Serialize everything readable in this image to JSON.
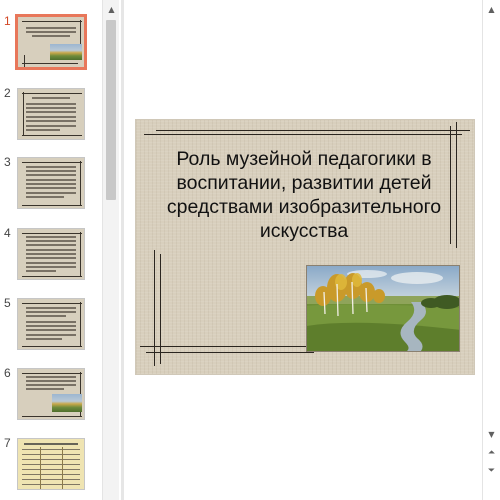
{
  "thumbnails": {
    "items": [
      {
        "number": "1"
      },
      {
        "number": "2"
      },
      {
        "number": "3"
      },
      {
        "number": "4"
      },
      {
        "number": "5"
      },
      {
        "number": "6"
      },
      {
        "number": "7"
      }
    ],
    "active_index": 0
  },
  "slide": {
    "title": "Роль музейной педагогики в воспитании, развитии детей средствами изобразительного искусства",
    "picture_icon": "landscape-painting"
  },
  "scrollbars": {
    "thumb_up_icon": "arrow-up",
    "main_up_icon": "arrow-up",
    "main_down_icon": "arrow-down",
    "prev_slide_icon": "double-arrow-up",
    "next_slide_icon": "double-arrow-down"
  }
}
